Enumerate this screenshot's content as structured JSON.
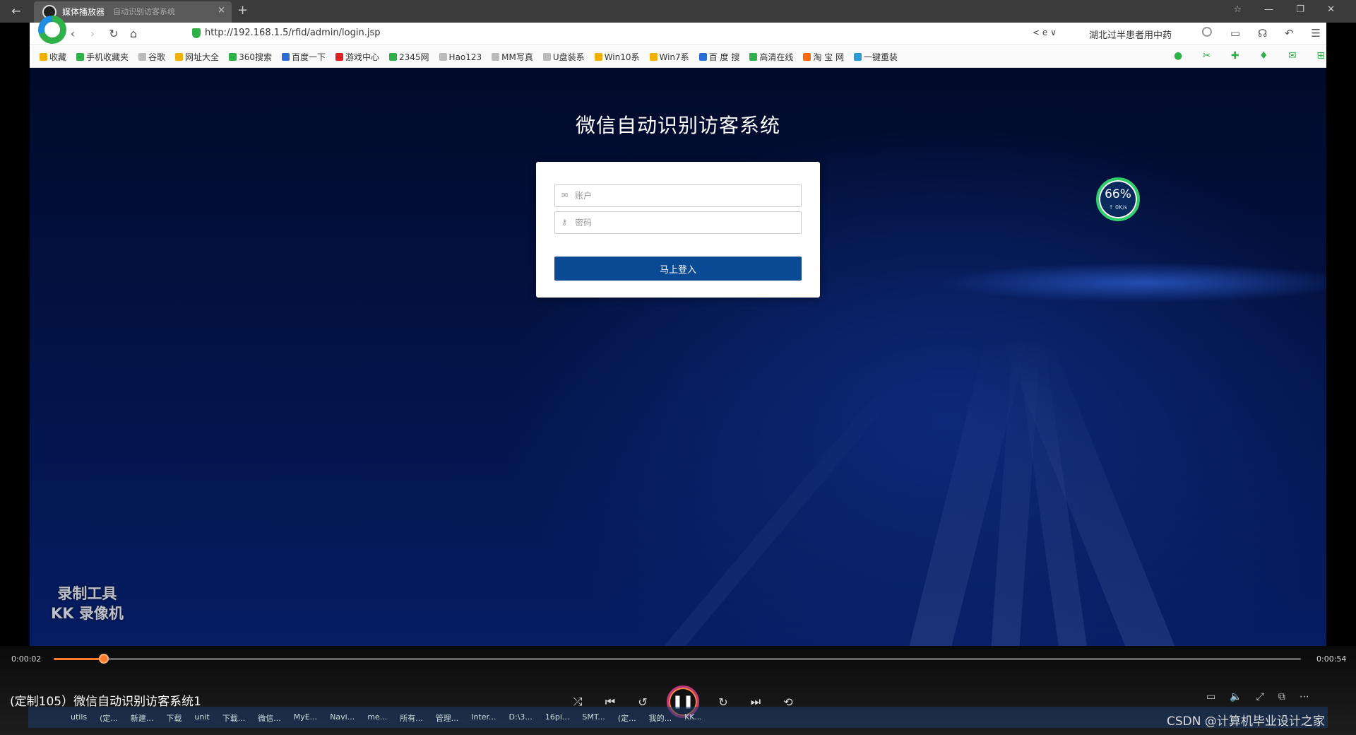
{
  "player": {
    "tab_title": "媒体播放器",
    "tab_subtitle": "自动识别访客系统",
    "tab_close": "×",
    "new_tab": "+",
    "window_controls": "☆ — ❐ ✕"
  },
  "browser": {
    "back": "‹",
    "forward": "›",
    "reload": "↻",
    "home": "⌂",
    "url": "http://192.168.1.5/rfid/admin/login.jsp",
    "share_icons": "< e ∨",
    "hot_search": "湖北过半患者用中药",
    "tool_icons": "▭ ☊ ↶ ☰",
    "favorites": [
      {
        "label": "收藏",
        "color": "#f0b000"
      },
      {
        "label": "手机收藏夹",
        "color": "#2fb14a"
      },
      {
        "label": "谷歌",
        "color": "#bbbbbb"
      },
      {
        "label": "网址大全",
        "color": "#f0b000"
      },
      {
        "label": "360搜索",
        "color": "#2fb14a"
      },
      {
        "label": "百度一下",
        "color": "#2b6bd6"
      },
      {
        "label": "游戏中心",
        "color": "#e02020"
      },
      {
        "label": "2345网",
        "color": "#2fb14a"
      },
      {
        "label": "Hao123",
        "color": "#bbbbbb"
      },
      {
        "label": "MM写真",
        "color": "#bbbbbb"
      },
      {
        "label": "U盘装系",
        "color": "#bbbbbb"
      },
      {
        "label": "Win10系",
        "color": "#f0b000"
      },
      {
        "label": "Win7系",
        "color": "#f0b000"
      },
      {
        "label": "百 度 搜",
        "color": "#2b6bd6"
      },
      {
        "label": "高清在线",
        "color": "#2fb14a"
      },
      {
        "label": "淘 宝 网",
        "color": "#ff6a00"
      },
      {
        "label": "一键重装",
        "color": "#2b9bd6"
      }
    ],
    "fav_tools": "● ✂ ✚ ♦ ✉ ⊞"
  },
  "page": {
    "title": "微信自动识别访客系统",
    "account_placeholder": "账户",
    "password_placeholder": "密码",
    "login_label": "马上登入",
    "net_percent": "66%",
    "net_speed": "↑ 0K/s"
  },
  "watermark": {
    "line1": "录制工具",
    "line2": "KK 录像机"
  },
  "controls": {
    "time_current": "0:00:02",
    "time_total": "0:00:54",
    "progress": 0.04,
    "video_title": "(定制105）微信自动识别访客系统1",
    "shuffle": "⤮",
    "prev": "⏮",
    "rewind": "↺",
    "pause": "❚❚",
    "forward": "↻",
    "next": "⏭",
    "repeat": "⟲",
    "right_icons": [
      "▭",
      "🔈",
      "⤢",
      "⧉",
      "⋯"
    ]
  },
  "taskbar": {
    "items": [
      "utils",
      "(定...",
      "新建...",
      "下载",
      "unit",
      "下载...",
      "微信...",
      "MyE...",
      "Navi...",
      "me...",
      "所有...",
      "管理...",
      "Inter...",
      "D:\\3...",
      "16pi...",
      "SMT...",
      "(定...",
      "我的...",
      "KK..."
    ]
  },
  "credit": "CSDN @计算机毕业设计之家"
}
